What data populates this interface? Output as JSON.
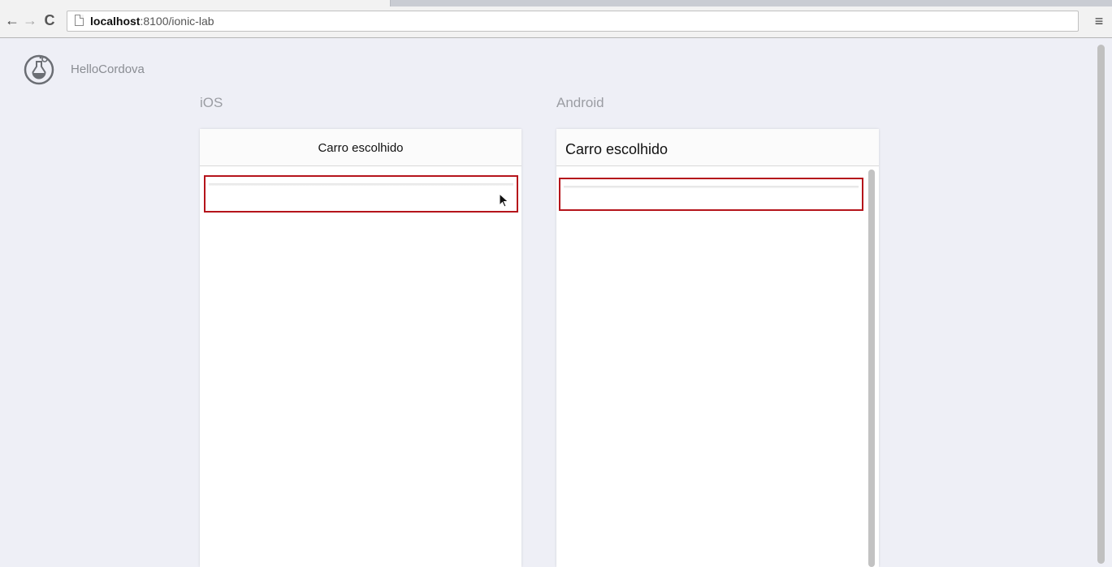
{
  "browser": {
    "nav": {
      "back_icon": "back-arrow-icon",
      "back_glyph": "←",
      "forward_icon": "forward-arrow-icon",
      "forward_glyph": "→",
      "reload_icon": "reload-icon",
      "reload_glyph": "C",
      "menu_icon": "hamburger-menu-icon",
      "menu_glyph": "≡"
    },
    "url": {
      "host": "localhost",
      "path": ":8100/ionic-lab"
    }
  },
  "app": {
    "logo_icon": "ionic-lab-flask-icon",
    "name": "HelloCordova"
  },
  "platforms": [
    {
      "label": "iOS",
      "nav_title": "Carro escolhido",
      "selected_item_text": ""
    },
    {
      "label": "Android",
      "nav_title": "Carro escolhido",
      "selected_item_text": ""
    }
  ],
  "colors": {
    "highlight_border": "#b5141b",
    "page_background": "#eeeff6",
    "label_gray": "#9b9da3"
  }
}
